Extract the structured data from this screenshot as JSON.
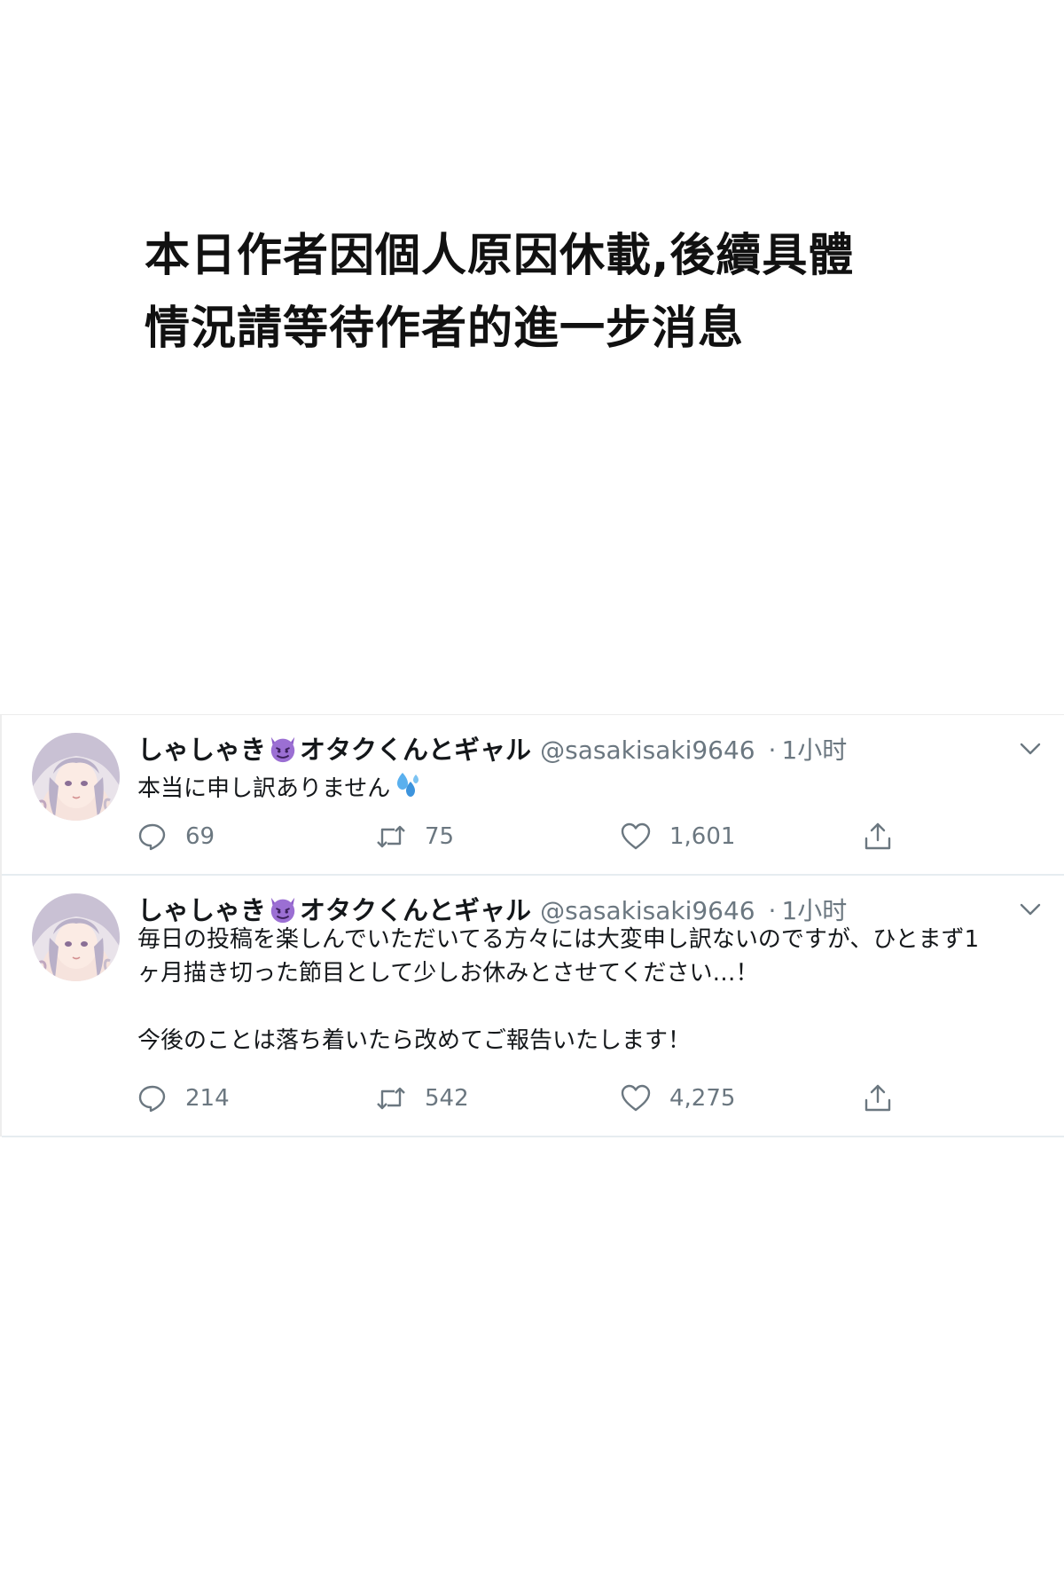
{
  "notice": {
    "line1": "本日作者因個人原因休載,後續具體",
    "line2": "情況請等待作者的進一步消息"
  },
  "tweets": [
    {
      "name_prefix": "しゃしゃき",
      "name_suffix": "オタクくんとギャル",
      "name_emoji": "devil-emoji",
      "handle": "@sasakisaki9646",
      "separator": "·",
      "time": "1小时",
      "text": "本当に申し訳ありません",
      "text_emoji": "sweat-droplets-emoji",
      "replies": "69",
      "retweets": "75",
      "likes": "1,601"
    },
    {
      "name_prefix": "しゃしゃき",
      "name_suffix": "オタクくんとギャル",
      "name_emoji": "devil-emoji",
      "handle": "@sasakisaki9646",
      "separator": "·",
      "time": "1小时",
      "text_line1": "毎日の投稿を楽しんでいただいてる方々には大変申し訳ないのですが、ひとまず1",
      "text_line2": "ヶ月描き切った節目として少しお休みとさせてください…！",
      "text_line3": "今後のことは落ち着いたら改めてご報告いたします！",
      "replies": "214",
      "retweets": "542",
      "likes": "4,275"
    }
  ],
  "colors": {
    "text": "#14171a",
    "muted": "#6b7780",
    "divider": "#e6ecf0",
    "devil": "#8e5fc9",
    "sweat": "#4aa3e8"
  }
}
